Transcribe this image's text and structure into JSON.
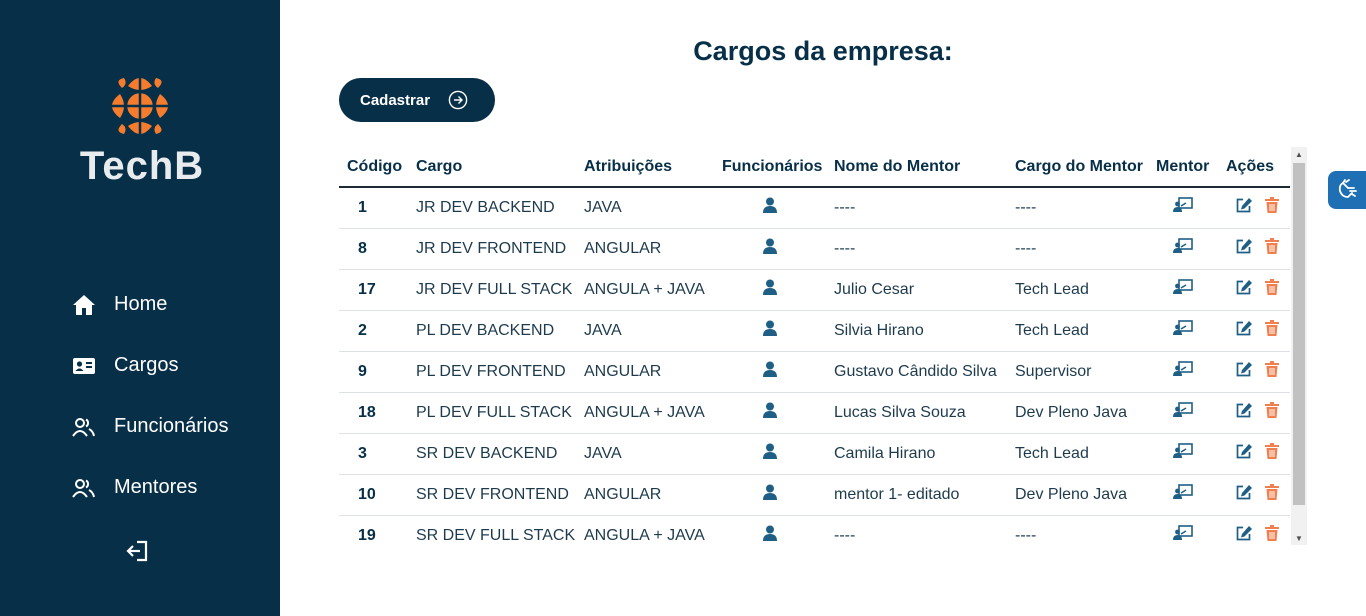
{
  "brand": {
    "name": "TechB",
    "logo_color": "#f47c2c"
  },
  "nav": {
    "items": [
      {
        "label": "Home",
        "icon": "home-icon"
      },
      {
        "label": "Cargos",
        "icon": "id-card-icon"
      },
      {
        "label": "Funcionários",
        "icon": "users-icon"
      },
      {
        "label": "Mentores",
        "icon": "users-icon"
      }
    ],
    "logout_icon": "logout-icon"
  },
  "main": {
    "title": "Cargos da empresa:",
    "add_button_label": "Cadastrar"
  },
  "table": {
    "headers": [
      "Código",
      "Cargo",
      "Atribuições",
      "Funcionários",
      "Nome do Mentor",
      "Cargo do Mentor",
      "Mentor",
      "Ações"
    ],
    "rows": [
      {
        "codigo": "1",
        "cargo": "JR DEV BACKEND",
        "atribuicoes": "JAVA",
        "mentor_nome": "----",
        "mentor_cargo": "----"
      },
      {
        "codigo": "8",
        "cargo": "JR DEV FRONTEND",
        "atribuicoes": "ANGULAR",
        "mentor_nome": "----",
        "mentor_cargo": "----"
      },
      {
        "codigo": "17",
        "cargo": "JR DEV FULL STACK",
        "atribuicoes": "ANGULA + JAVA",
        "mentor_nome": "Julio Cesar",
        "mentor_cargo": "Tech Lead"
      },
      {
        "codigo": "2",
        "cargo": "PL DEV BACKEND",
        "atribuicoes": "JAVA",
        "mentor_nome": "Silvia Hirano",
        "mentor_cargo": "Tech Lead"
      },
      {
        "codigo": "9",
        "cargo": "PL DEV FRONTEND",
        "atribuicoes": "ANGULAR",
        "mentor_nome": "Gustavo Cândido Silva",
        "mentor_cargo": "Supervisor"
      },
      {
        "codigo": "18",
        "cargo": "PL DEV FULL STACK",
        "atribuicoes": "ANGULA + JAVA",
        "mentor_nome": "Lucas Silva Souza",
        "mentor_cargo": "Dev Pleno Java"
      },
      {
        "codigo": "3",
        "cargo": "SR DEV BACKEND",
        "atribuicoes": "JAVA",
        "mentor_nome": "Camila Hirano",
        "mentor_cargo": "Tech Lead"
      },
      {
        "codigo": "10",
        "cargo": "SR DEV FRONTEND",
        "atribuicoes": "ANGULAR",
        "mentor_nome": "mentor 1- editado",
        "mentor_cargo": "Dev Pleno Java"
      },
      {
        "codigo": "19",
        "cargo": "SR DEV FULL STACK",
        "atribuicoes": "ANGULA + JAVA",
        "mentor_nome": "----",
        "mentor_cargo": "----"
      }
    ]
  },
  "colors": {
    "sidebar": "#072f47",
    "primary": "#072f47",
    "icon_blue": "#1f5f86",
    "delete": "#f07f4f",
    "accessibility": "#1f6fb4"
  },
  "accessibility_icon": "sign-language-icon"
}
